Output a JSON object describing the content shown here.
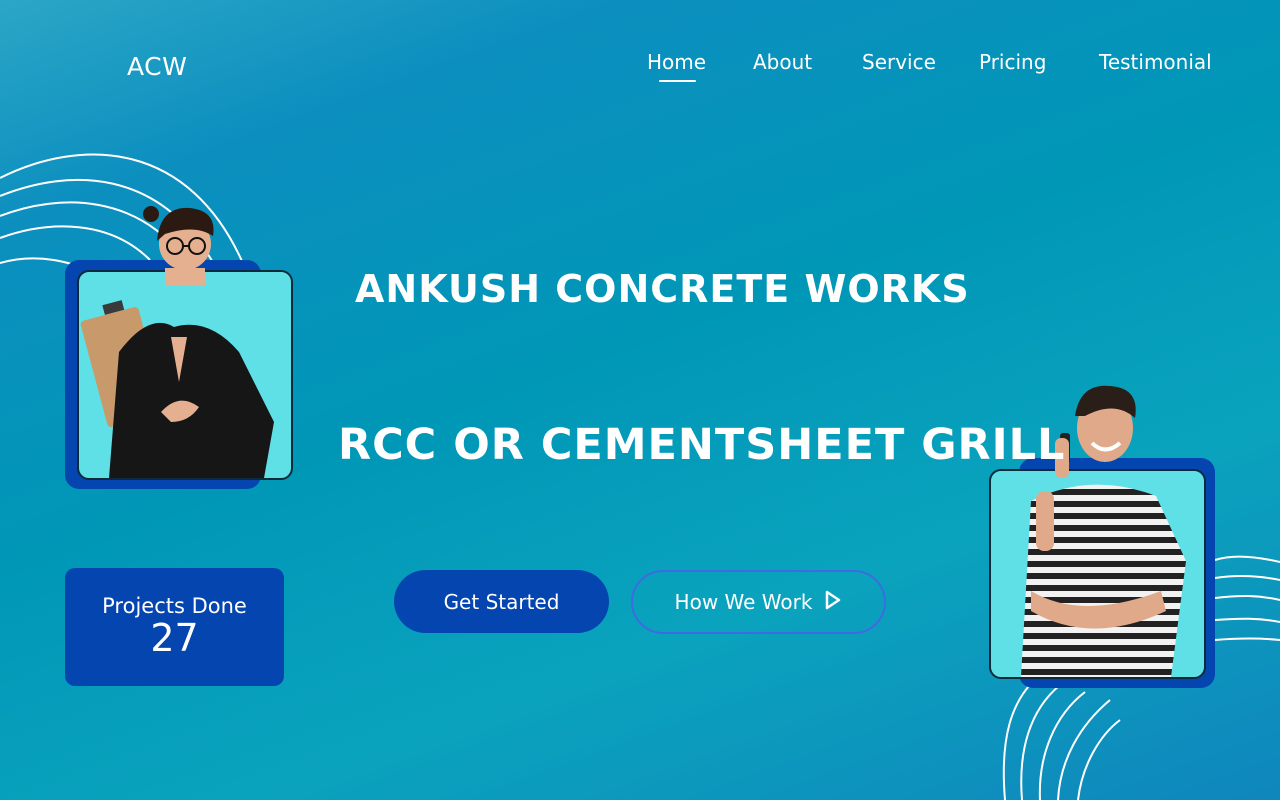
{
  "brand": {
    "logo": "ACW"
  },
  "nav": {
    "items": [
      {
        "label": "Home",
        "active": true
      },
      {
        "label": "About"
      },
      {
        "label": "Service"
      },
      {
        "label": "Pricing"
      },
      {
        "label": "Testimonial"
      }
    ]
  },
  "hero": {
    "title": "ANKUSH CONCRETE WORKS",
    "subtitle": "RCC OR CEMENTSHEET GRILL"
  },
  "stats": {
    "label": "Projects Done",
    "value": "27"
  },
  "buttons": {
    "primary": "Get Started",
    "secondary": "How We Work"
  },
  "colors": {
    "frame": "#0445b0",
    "photo_bg": "#5fe0e6",
    "outline": "#3f6be0"
  }
}
